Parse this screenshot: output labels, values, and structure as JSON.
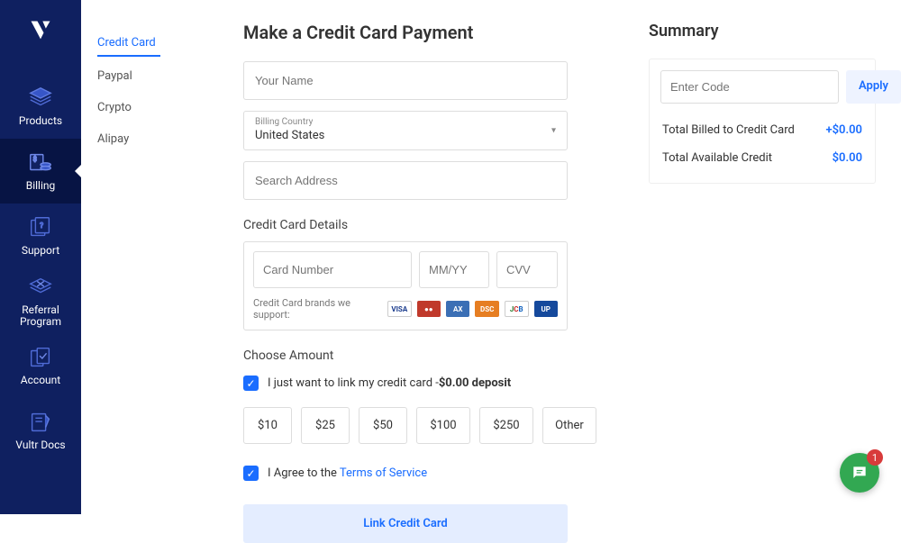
{
  "sidebar": {
    "items": [
      {
        "label": "Products"
      },
      {
        "label": "Billing"
      },
      {
        "label": "Support"
      },
      {
        "label": "Referral\nProgram"
      },
      {
        "label": "Account"
      },
      {
        "label": "Vultr Docs"
      }
    ]
  },
  "tabs": {
    "credit_card": "Credit Card",
    "paypal": "Paypal",
    "crypto": "Crypto",
    "alipay": "Alipay"
  },
  "form": {
    "title": "Make a Credit Card Payment",
    "name_placeholder": "Your Name",
    "country_label": "Billing Country",
    "country_value": "United States",
    "address_placeholder": "Search Address",
    "cc_section_title": "Credit Card Details",
    "cc_number_placeholder": "Card Number",
    "cc_exp_placeholder": "MM/YY",
    "cc_cvv_placeholder": "CVV",
    "cc_brands_label": "Credit Card brands we support:",
    "choose_amount_title": "Choose Amount",
    "link_only_prefix": "I just want to link my credit card -",
    "link_only_bold": "$0.00 deposit",
    "amounts": [
      "$10",
      "$25",
      "$50",
      "$100",
      "$250",
      "Other"
    ],
    "agree_prefix": "I Agree to the ",
    "agree_link": "Terms of Service",
    "submit_label": "Link Credit Card"
  },
  "summary": {
    "title": "Summary",
    "code_placeholder": "Enter Code",
    "apply_label": "Apply",
    "billed_label": "Total Billed to Credit Card",
    "billed_value": "+$0.00",
    "credit_label": "Total Available Credit",
    "credit_value": "$0.00"
  },
  "chat": {
    "badge": "1"
  }
}
